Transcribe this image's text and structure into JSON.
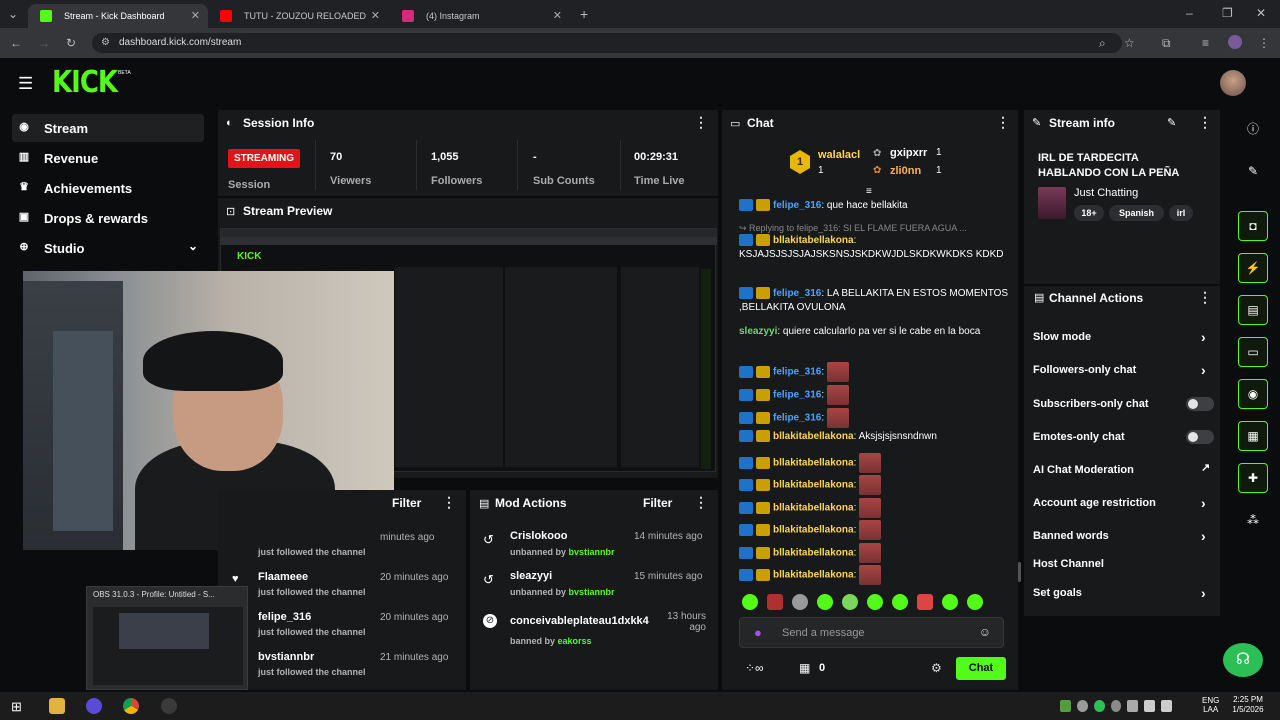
{
  "browser": {
    "tabs": [
      {
        "label": "Stream - Kick Dashboard",
        "color": "#53fc18"
      },
      {
        "label": "TUTU - ZOUZOU RELOADED",
        "color": "#ff0000"
      },
      {
        "label": "(4) Instagram",
        "color": "#d62976"
      }
    ],
    "url": "dashboard.kick.com/stream"
  },
  "app": {
    "logo": "KICK",
    "beta": "BETA",
    "accent": "#53fc18"
  },
  "sidebar": {
    "items": [
      {
        "label": "Stream",
        "icon": "broadcast-icon"
      },
      {
        "label": "Revenue",
        "icon": "chart-icon"
      },
      {
        "label": "Achievements",
        "icon": "trophy-icon"
      },
      {
        "label": "Drops & rewards",
        "icon": "gift-icon"
      },
      {
        "label": "Studio",
        "icon": "studio-icon"
      }
    ]
  },
  "session": {
    "title": "Session Info",
    "status": "STREAMING",
    "status_label": "Session",
    "stats": [
      {
        "value": "70",
        "label": "Viewers"
      },
      {
        "value": "1,055",
        "label": "Followers"
      },
      {
        "value": "-",
        "label": "Sub Counts"
      },
      {
        "value": "00:29:31",
        "label": "Time Live"
      }
    ]
  },
  "preview": {
    "title": "Stream Preview"
  },
  "followers": {
    "filter": "Filter",
    "items": [
      {
        "name": "",
        "sub": "just followed the channel",
        "time": "minutes ago"
      },
      {
        "name": "Flaameee",
        "sub": "just followed the channel",
        "time": "20 minutes ago"
      },
      {
        "name": "felipe_316",
        "sub": "just followed the channel",
        "time": "20 minutes ago"
      },
      {
        "name": "bvstiannbr",
        "sub": "just followed the channel",
        "time": "21 minutes ago"
      }
    ]
  },
  "mod_actions": {
    "title": "Mod Actions",
    "filter": "Filter",
    "items": [
      {
        "name": "Crislokooo",
        "action": "unbanned by",
        "by": "bvstiannbr",
        "time": "14 minutes ago"
      },
      {
        "name": "sleazyyi",
        "action": "unbanned by",
        "by": "bvstiannbr",
        "time": "15 minutes ago"
      },
      {
        "name": "conceivableplateau1dxkk4",
        "action": "banned by",
        "by": "eakorss",
        "time": "13 hours ago"
      }
    ]
  },
  "chat": {
    "title": "Chat",
    "top": [
      {
        "name": "walalacl",
        "count": "1",
        "rank": "1"
      },
      {
        "name": "gxipxrr",
        "count": "1"
      },
      {
        "name": "zli0nn",
        "count": "1"
      }
    ],
    "messages": [
      {
        "user": "felipe_316",
        "color": "#4aa3ff",
        "text": ": que hace bellakita"
      },
      {
        "reply": "Replying to felipe_316: SI EL FLAME FUERA AGUA ..."
      },
      {
        "user": "bllakitabellakona",
        "color": "#ffd64a",
        "text": ":"
      },
      {
        "text": "KSJAJSJSJSJAJSKSNSJSKDKWJDLSKDKWKDKS KDKD"
      },
      {
        "user": "felipe_316",
        "color": "#4aa3ff",
        "text": ": LA BELLAKITA EN ESTOS MOMENTOS ,BELLAKITA OVULONA"
      },
      {
        "user": "sleazyyi",
        "color": "#6bd96b",
        "text": ": quiere calcularlo pa ver si le cabe en la boca"
      },
      {
        "user": "felipe_316",
        "color": "#4aa3ff",
        "text": ":"
      },
      {
        "user": "felipe_316",
        "color": "#4aa3ff",
        "text": ":"
      },
      {
        "user": "felipe_316",
        "color": "#4aa3ff",
        "text": ":"
      },
      {
        "user": "bllakitabellakona",
        "color": "#ffd64a",
        "text": ": Aksjsjsjsnsndnwn"
      },
      {
        "user": "bllakitabellakona",
        "color": "#ffd64a",
        "text": ":"
      },
      {
        "user": "bllakitabellakona",
        "color": "#ffd64a",
        "text": ":"
      },
      {
        "user": "bllakitabellakona",
        "color": "#ffd64a",
        "text": ":"
      },
      {
        "user": "bllakitabellakona",
        "color": "#ffd64a",
        "text": ":"
      },
      {
        "user": "bllakitabellakona",
        "color": "#ffd64a",
        "text": ":"
      },
      {
        "user": "bllakitabellakona",
        "color": "#ffd64a",
        "text": ":"
      }
    ],
    "placeholder": "Send a message",
    "points": "0",
    "send_label": "Chat"
  },
  "stream_info": {
    "title": "Stream info",
    "stream_title": "IRL DE TARDECITA HABLANDO CON LA PEÑA",
    "category": "Just Chatting",
    "tags": [
      "18+",
      "Spanish",
      "irl"
    ]
  },
  "channel_actions": {
    "title": "Channel Actions",
    "items": [
      {
        "label": "Slow mode",
        "control": "arrow"
      },
      {
        "label": "Followers-only chat",
        "control": "arrow"
      },
      {
        "label": "Subscribers-only chat",
        "control": "toggle"
      },
      {
        "label": "Emotes-only chat",
        "control": "toggle"
      },
      {
        "label": "AI Chat Moderation",
        "control": "external"
      },
      {
        "label": "Account age restriction",
        "control": "arrow"
      },
      {
        "label": "Banned words",
        "control": "arrow"
      },
      {
        "label": "Host Channel",
        "control": "none"
      },
      {
        "label": "Set goals",
        "control": "arrow"
      }
    ]
  },
  "obs": {
    "title": "OBS 31.0.3 - Profile: Untitled - S..."
  },
  "taskbar": {
    "lang": "ENG",
    "layout": "LAA",
    "time": "2:25 PM",
    "date": "1/5/2026"
  }
}
